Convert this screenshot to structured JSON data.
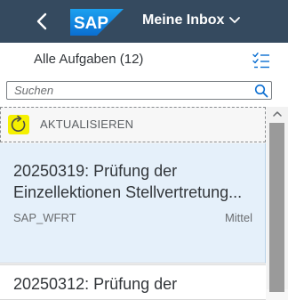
{
  "shell": {
    "back_icon": "chevron-left-icon",
    "logo_text": "SAP",
    "app_title": "Meine Inbox",
    "title_menu_icon": "chevron-down-icon",
    "color": "#354a5f",
    "logo_color": "#0a6ed1"
  },
  "list": {
    "title": "Alle Aufgaben (12)",
    "filter_icon": "checklist-icon"
  },
  "search": {
    "placeholder": "Suchen",
    "icon": "search-icon"
  },
  "refresh": {
    "label": "AKTUALISIEREN",
    "icon": "refresh-icon",
    "highlight": "#f5f000"
  },
  "tasks": [
    {
      "title": "20250319: Prüfung der Einzellektionen Stellvertretung...",
      "creator": "SAP_WFRT",
      "priority": "Mittel",
      "selected": true
    },
    {
      "title": "20250312: Prüfung der",
      "selected": false
    }
  ]
}
